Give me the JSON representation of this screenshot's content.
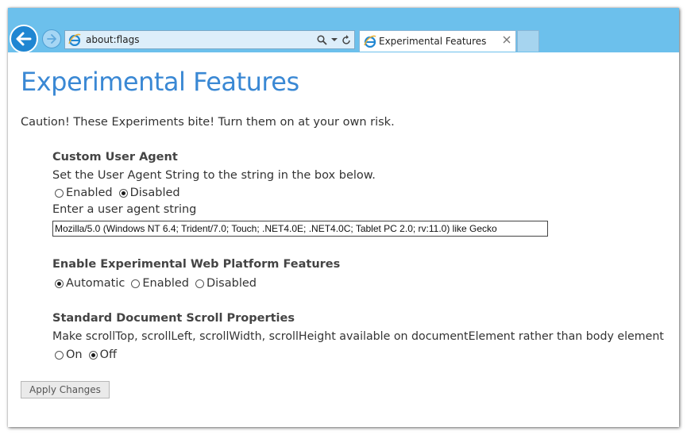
{
  "browser": {
    "address": "about:flags",
    "tab_title": "Experimental Features",
    "colors": {
      "toolbar": "#6cc0ec",
      "accent": "#1f86d2",
      "title": "#3a88d4"
    },
    "icons": [
      "back-arrow-icon",
      "forward-arrow-icon",
      "ie-logo-icon",
      "search-icon",
      "dropdown-icon",
      "refresh-icon",
      "close-icon"
    ]
  },
  "page": {
    "title": "Experimental Features",
    "caution": "Caution! These Experiments bite! Turn them on at your own risk."
  },
  "sections": [
    {
      "title": "Custom User Agent",
      "description": "Set the User Agent String to the string in the box below.",
      "options": [
        {
          "label": "Enabled",
          "checked": false
        },
        {
          "label": "Disabled",
          "checked": true
        }
      ],
      "input_label": "Enter a user agent string",
      "input_value": "Mozilla/5.0 (Windows NT 6.4; Trident/7.0; Touch; .NET4.0E; .NET4.0C; Tablet PC 2.0; rv:11.0) like Gecko"
    },
    {
      "title": "Enable Experimental Web Platform Features",
      "options": [
        {
          "label": "Automatic",
          "checked": true
        },
        {
          "label": "Enabled",
          "checked": false
        },
        {
          "label": "Disabled",
          "checked": false
        }
      ]
    },
    {
      "title": "Standard Document Scroll Properties",
      "description": "Make scrollTop, scrollLeft, scrollWidth, scrollHeight available on documentElement rather than body element",
      "options": [
        {
          "label": "On",
          "checked": false
        },
        {
          "label": "Off",
          "checked": true
        }
      ]
    }
  ],
  "apply_button": "Apply Changes"
}
